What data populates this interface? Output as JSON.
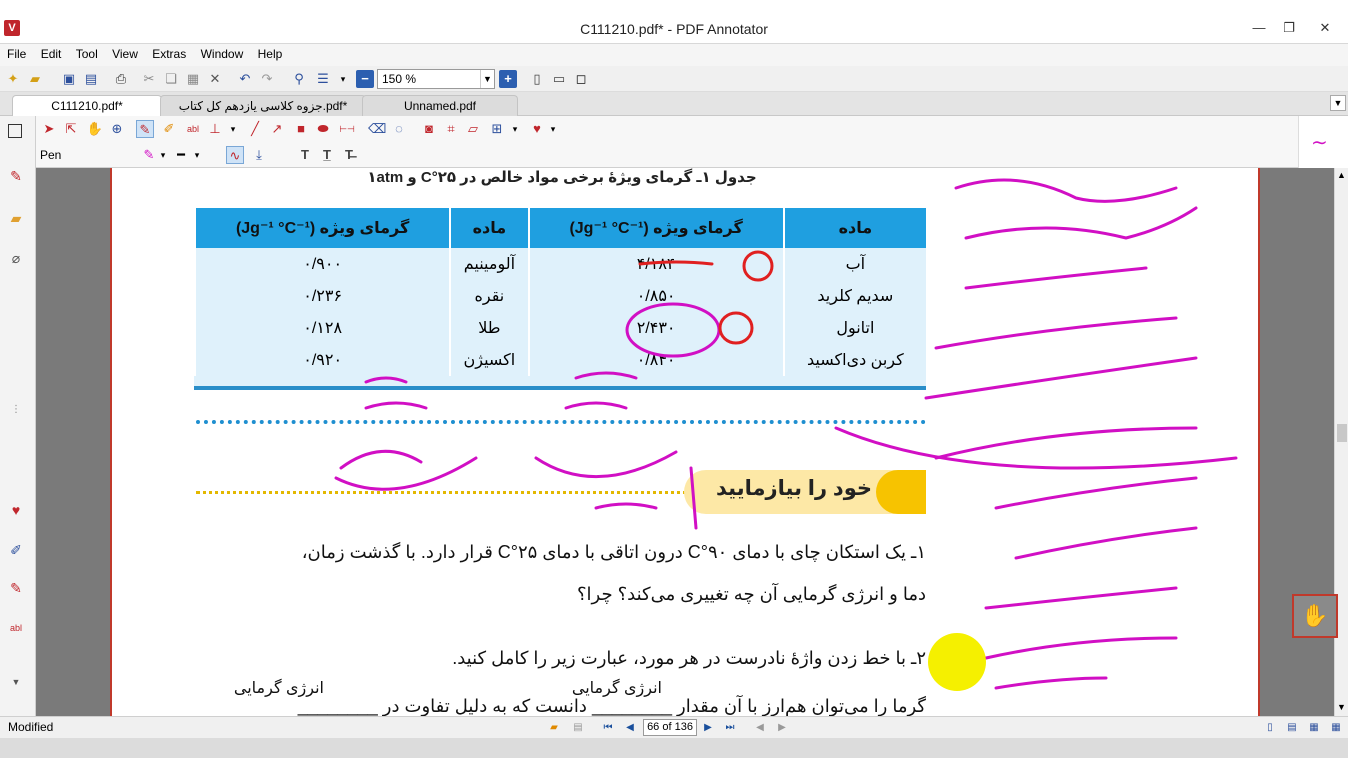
{
  "window": {
    "title": "C111210.pdf* - PDF Annotator",
    "app_icon_letter": "V",
    "controls": [
      "—",
      "❐",
      "✕"
    ]
  },
  "menu": [
    "File",
    "Edit",
    "Tool",
    "View",
    "Extras",
    "Window",
    "Help"
  ],
  "toolbar": {
    "zoom_value": "150 %"
  },
  "tabs": [
    {
      "label": "C111210.pdf*",
      "active": true
    },
    {
      "label": "جزوه کلاسی یازدهم کل کتاب.pdf*",
      "active": false
    },
    {
      "label": "Unnamed.pdf",
      "active": false
    }
  ],
  "pen_toolbar": {
    "tool_label": "Pen"
  },
  "document": {
    "table_caption": "جدول ۱ـ گرمای ویژهٔ برخی مواد خالص در ۲۵°C و ۱atm",
    "table_headers": [
      "ماده",
      "گرمای ویژه (Jg⁻¹ °C⁻¹)",
      "ماده",
      "گرمای ویژه (Jg⁻¹ °C⁻¹)"
    ],
    "table_rows": [
      [
        "آب",
        "۴/۱۸۴",
        "آلومینیم",
        "۰/۹۰۰"
      ],
      [
        "سدیم کلرید",
        "۰/۸۵۰",
        "نقره",
        "۰/۲۳۶"
      ],
      [
        "اتانول",
        "۲/۴۳۰",
        "طلا",
        "۰/۱۲۸"
      ],
      [
        "کربن دی‌اکسید",
        "۰/۸۴۰",
        "اکسیژن",
        "۰/۹۲۰"
      ]
    ],
    "section_heading": "خود را بیازمایید",
    "q1_line1": "۱ـ یک استکان چای با دمای ۹۰°C درون اتاقی با دمای ۲۵°C قرار دارد. با گذشت زمان،",
    "q1_line2": "دما و انرژی گرمایی آن چه تغییری می‌کند؟ چرا؟",
    "q2_line1": "۲ـ با خط زدن واژهٔ نادرست در هر مورد، عبارت زیر را کامل کنید.",
    "q2_line2": "گرما را می‌توان هم‌ارز با آن مقدار ________ دانست که به دلیل تفاوت در ________",
    "q2_above_1": "انرژی گرمایی",
    "q2_above_2": "انرژی گرمایی"
  },
  "status": {
    "left_text": "Modified",
    "page_indicator": "66 of 136"
  },
  "colors": {
    "accent_red": "#c0392b",
    "table_header_blue": "#1f9fe0",
    "table_body_blue": "#dff1fb",
    "ink_magenta": "#d10fc4",
    "ink_red": "#e02020",
    "highlight_yellow": "#f5f000"
  }
}
